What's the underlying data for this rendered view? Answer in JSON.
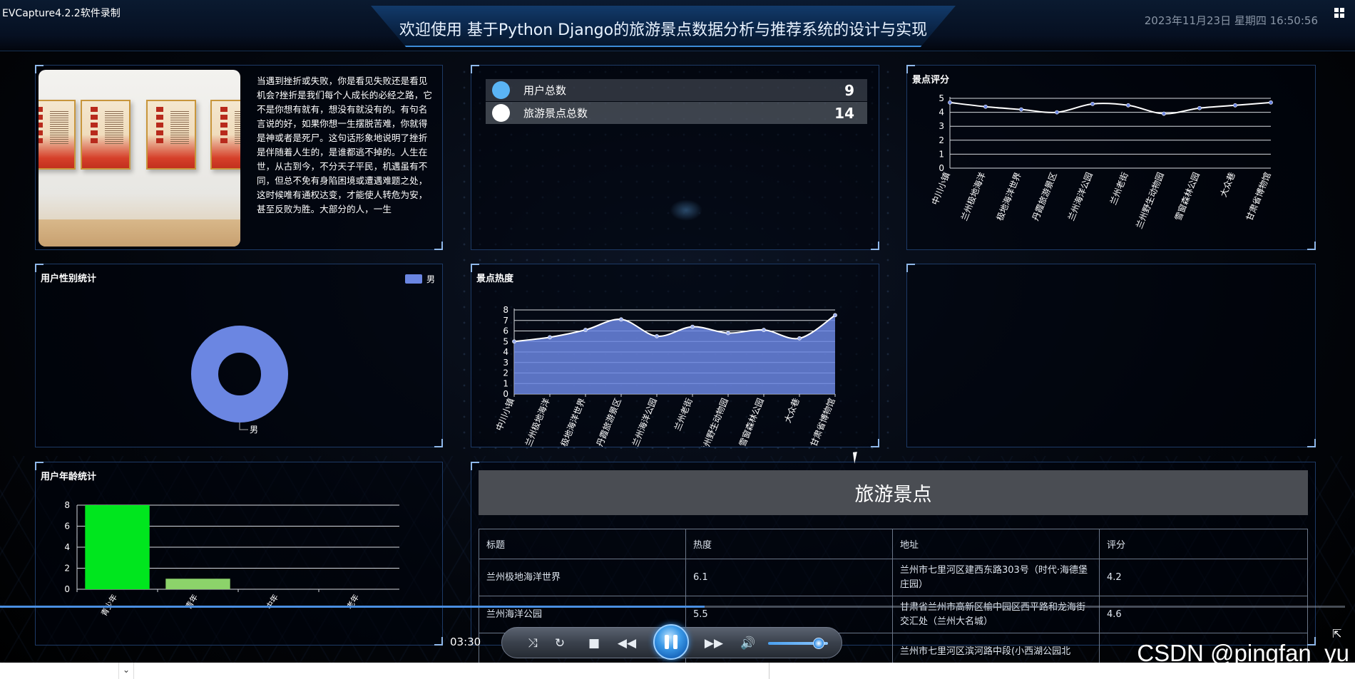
{
  "recorder_label": "EVCapture4.2.2软件录制",
  "header": {
    "title": "欢迎使用 基于Python Django的旅游景点数据分析与推荐系统的设计与实现",
    "datetime": "2023年11月23日 星期四 16:50:56"
  },
  "intro": {
    "text": "当遇到挫折或失败，你是看见失败还是看见机会?挫折是我们每个人成长的必经之路，它不是你想有就有，想没有就没有的。有句名言说的好，如果你想一生摆脱苦难，你就得是神或者是死尸。这句话形象地说明了挫折是伴随着人生的，是谁都逃不掉的。人生在世，从古到今，不分天子平民，机遇虽有不同，但总不免有身陷困境或遭遇难题之处，这时候唯有通权达变，才能使人转危为安，甚至反败为胜。大部分的人，一生"
  },
  "stats": {
    "items": [
      {
        "label": "用户总数",
        "value": "9",
        "dot_color": "#5ab4f5"
      },
      {
        "label": "旅游景点总数",
        "value": "14",
        "dot_color": "#ffffff"
      }
    ]
  },
  "panels": {
    "score_title": "景点评分",
    "gender_title": "用户性别统计",
    "heat_title": "景点热度",
    "age_title": "用户年龄统计",
    "table_title": "旅游景点"
  },
  "chart_data": [
    {
      "id": "score",
      "type": "line",
      "title": "景点评分",
      "categories": [
        "中川小镇",
        "兰州极地海洋",
        "极地海洋世界",
        "丹霞旅游景区",
        "兰州海洋公园",
        "兰州老街",
        "兰州野生动物园",
        "雪窗森林公园",
        "大众巷",
        "甘肃省博物馆"
      ],
      "values": [
        4.7,
        4.4,
        4.2,
        4.0,
        4.6,
        4.5,
        3.9,
        4.3,
        4.5,
        4.7
      ],
      "ylim": [
        0,
        5
      ],
      "yticks": [
        "0",
        "1",
        "2",
        "3",
        "4",
        "5"
      ],
      "color": "#ffffff",
      "point_color": "#6b86e2"
    },
    {
      "id": "gender",
      "type": "pie",
      "title": "用户性别统计",
      "labels": [
        "男"
      ],
      "values": [
        9
      ],
      "legend": "top-right",
      "color": "#6b86e2"
    },
    {
      "id": "heat",
      "type": "area",
      "title": "景点热度",
      "categories": [
        "中川小镇",
        "兰州极地海洋",
        "极地海洋世界",
        "丹霞旅游景区",
        "兰州海洋公园",
        "兰州老街",
        "兰州野生动物园",
        "雪窗森林公园",
        "大众巷",
        "甘肃省博物馆"
      ],
      "values": [
        5.0,
        5.4,
        6.1,
        7.1,
        5.5,
        6.4,
        5.8,
        6.1,
        5.3,
        7.5
      ],
      "ylim": [
        0,
        8
      ],
      "yticks": [
        "0",
        "1",
        "2",
        "3",
        "4",
        "5",
        "6",
        "7",
        "8"
      ],
      "color": "#6b86e2"
    },
    {
      "id": "age",
      "type": "bar",
      "title": "用户年龄统计",
      "categories": [
        "青少年",
        "青年",
        "中年",
        "老年"
      ],
      "values": [
        8,
        1,
        0,
        0
      ],
      "ylim": [
        0,
        8
      ],
      "yticks": [
        "0",
        "2",
        "4",
        "6",
        "8"
      ],
      "colors": [
        "#00e61e",
        "#8cd36a",
        "#6b86e2",
        "#6b86e2"
      ]
    }
  ],
  "table": {
    "columns": [
      "标题",
      "热度",
      "地址",
      "评分"
    ],
    "rows": [
      [
        "兰州极地海洋世界",
        "6.1",
        "兰州市七里河区建西东路303号（时代·海德堡庄园）",
        "4.2"
      ],
      [
        "兰州海洋公园",
        "5.5",
        "甘肃省兰州市高新区榆中园区西平路和龙海街交汇处（兰州大名城）",
        "4.6"
      ],
      [
        "",
        "",
        "兰州市七里河区滨河路中段(小西湖公园北",
        ""
      ]
    ]
  },
  "player": {
    "elapsed": "03:30",
    "progress": 0.524,
    "volume": 0.85
  },
  "watermark": "CSDN @pingfan_yu"
}
